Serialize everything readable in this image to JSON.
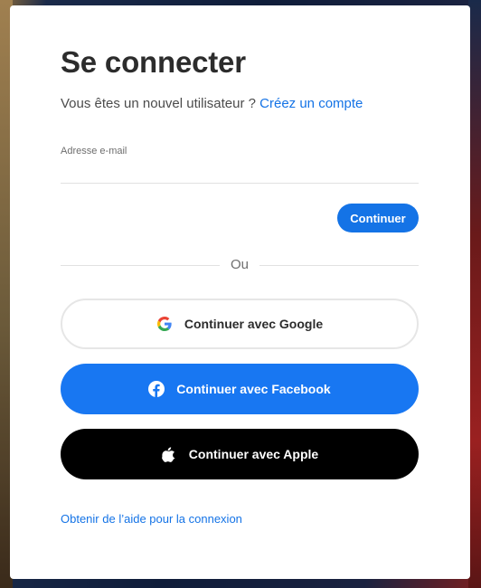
{
  "title": "Se connecter",
  "new_user": {
    "prompt": "Vous êtes un nouvel utilisateur ?",
    "link": "Créez un compte"
  },
  "email": {
    "label": "Adresse e-mail",
    "value": "",
    "placeholder": ""
  },
  "continue_label": "Continuer",
  "divider_text": "Ou",
  "social": {
    "google": {
      "label": "Continuer avec Google",
      "icon": "google-icon"
    },
    "facebook": {
      "label": "Continuer avec Facebook",
      "icon": "facebook-icon"
    },
    "apple": {
      "label": "Continuer avec Apple",
      "icon": "apple-icon"
    }
  },
  "help_link": "Obtenir de l’aide pour la connexion",
  "colors": {
    "accent": "#1473e6",
    "facebook": "#1877f2",
    "apple": "#000000"
  }
}
